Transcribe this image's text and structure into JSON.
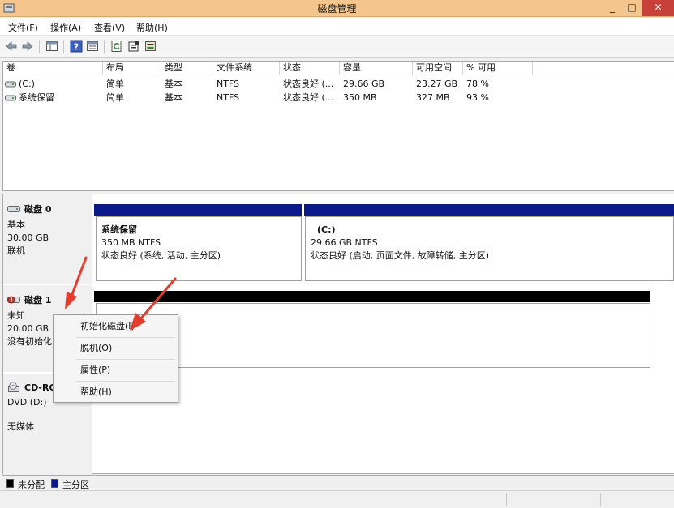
{
  "window": {
    "title": "磁盘管理",
    "minimize_glyph": "_",
    "maximize_glyph": "□",
    "close_glyph": "✕"
  },
  "menu": [
    "文件(F)",
    "操作(A)",
    "查看(V)",
    "帮助(H)"
  ],
  "toolbar_icons": [
    "back-arrow-icon",
    "forward-arrow-icon",
    "console-tree-icon",
    "help-icon",
    "properties-list-icon",
    "refresh-icon",
    "properties-icon",
    "rescan-disks-icon"
  ],
  "volume_table": {
    "columns": [
      "卷",
      "布局",
      "类型",
      "文件系统",
      "状态",
      "容量",
      "可用空间",
      "% 可用"
    ],
    "rows": [
      [
        "(C:)",
        "简单",
        "基本",
        "NTFS",
        "状态良好 (...",
        "29.66 GB",
        "23.27 GB",
        "78 %"
      ],
      [
        "系统保留",
        "简单",
        "基本",
        "NTFS",
        "状态良好 (...",
        "350 MB",
        "327 MB",
        "93 %"
      ]
    ]
  },
  "disks": [
    {
      "name": "磁盘 0",
      "type": "基本",
      "size": "30.00 GB",
      "status": "联机",
      "partitions": [
        {
          "name": "系统保留",
          "size_fs": "350 MB NTFS",
          "status": "状态良好 (系统, 活动, 主分区)"
        },
        {
          "name": "(C:)",
          "size_fs": "29.66 GB NTFS",
          "status": "状态良好 (启动, 页面文件, 故障转储, 主分区)"
        }
      ]
    },
    {
      "name": "磁盘 1",
      "type": "未知",
      "size": "20.00 GB",
      "status": "没有初始化"
    },
    {
      "name": "CD-RO",
      "drive": "DVD (D:)",
      "status": "无媒体"
    }
  ],
  "context_menu": [
    "初始化磁盘(I)",
    "脱机(O)",
    "属性(P)",
    "帮助(H)"
  ],
  "legend": [
    {
      "label": "未分配",
      "color": "#000000"
    },
    {
      "label": "主分区",
      "color": "#0a1a8c"
    }
  ],
  "colors": {
    "title_bar": "#f4c68d",
    "close_button": "#c7413a",
    "primary_partition": "#0a1a8c",
    "unallocated": "#000000",
    "annotation_arrow": "#e53b2c"
  }
}
